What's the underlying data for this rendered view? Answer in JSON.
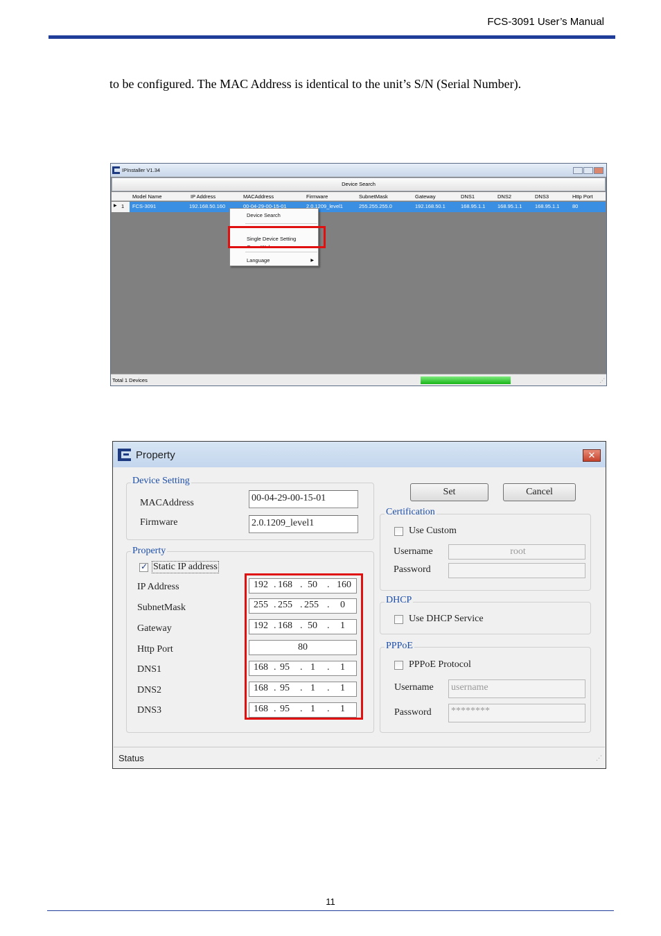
{
  "header": {
    "title": "FCS-3091 User’s Manual"
  },
  "body_text": "to be configured. The MAC Address is identical to the unit’s S/N (Serial Number).",
  "footer": {
    "page_number": "11"
  },
  "ipinstaller": {
    "window_title": "IPInstaller V1.34",
    "search_button": "Device Search",
    "columns": [
      "Model Name",
      "IP Address",
      "MACAddress",
      "Firmware",
      "SubnetMask",
      "Gateway",
      "DNS1",
      "DNS2",
      "DNS3",
      "Http Port"
    ],
    "row": {
      "index": "1",
      "model": "FCS-3091",
      "ip": "192.168.50.160",
      "mac": "00-04-29-00-15-01",
      "firmware": "2.0.1209_level1",
      "subnet": "255.255.255.0",
      "gateway": "192.168.50.1",
      "dns1": "168.95.1.1",
      "dns2": "168.95.1.1",
      "dns3": "168.95.1.1",
      "http_port": "80"
    },
    "context_menu": {
      "items": [
        "Device Search",
        "Single Device Setting",
        "Open Web",
        "Language"
      ]
    },
    "status_text": "Total 1 Devices",
    "progress_fraction": 1.0
  },
  "property": {
    "title": "Property",
    "close_glyph": "✕",
    "device_setting": {
      "group_title": "Device Setting",
      "mac_label": "MACAddress",
      "mac_value": "00-04-29-00-15-01",
      "firmware_label": "Firmware",
      "firmware_value": "2.0.1209_level1"
    },
    "prop": {
      "group_title": "Property",
      "static_ip_label": "Static IP address",
      "static_ip_checked": true,
      "ip_label": "IP Address",
      "ip": [
        "192",
        "168",
        "50",
        "160"
      ],
      "subnet_label": "SubnetMask",
      "subnet": [
        "255",
        "255",
        "255",
        "0"
      ],
      "gateway_label": "Gateway",
      "gateway": [
        "192",
        "168",
        "50",
        "1"
      ],
      "http_label": "Http Port",
      "http_port": "80",
      "dns1_label": "DNS1",
      "dns1": [
        "168",
        "95",
        "1",
        "1"
      ],
      "dns2_label": "DNS2",
      "dns2": [
        "168",
        "95",
        "1",
        "1"
      ],
      "dns3_label": "DNS3",
      "dns3": [
        "168",
        "95",
        "1",
        "1"
      ]
    },
    "set_button": "Set",
    "cancel_button": "Cancel",
    "certification": {
      "group_title": "Certification",
      "use_custom_label": "Use Custom",
      "use_custom_checked": false,
      "username_label": "Username",
      "username_value": "root",
      "password_label": "Password",
      "password_value": ""
    },
    "dhcp": {
      "group_title": "DHCP",
      "use_dhcp_label": "Use DHCP Service",
      "use_dhcp_checked": false
    },
    "pppoe": {
      "group_title": "PPPoE",
      "protocol_label": "PPPoE Protocol",
      "protocol_checked": false,
      "username_label": "Username",
      "username_placeholder": "username",
      "password_label": "Password",
      "password_value": "********"
    },
    "status_text": "Status"
  },
  "colors": {
    "accent_rule": "#1f3d99",
    "highlight": "#e01010",
    "selection": "#3a8fe3",
    "group_title": "#1c4ea8"
  }
}
